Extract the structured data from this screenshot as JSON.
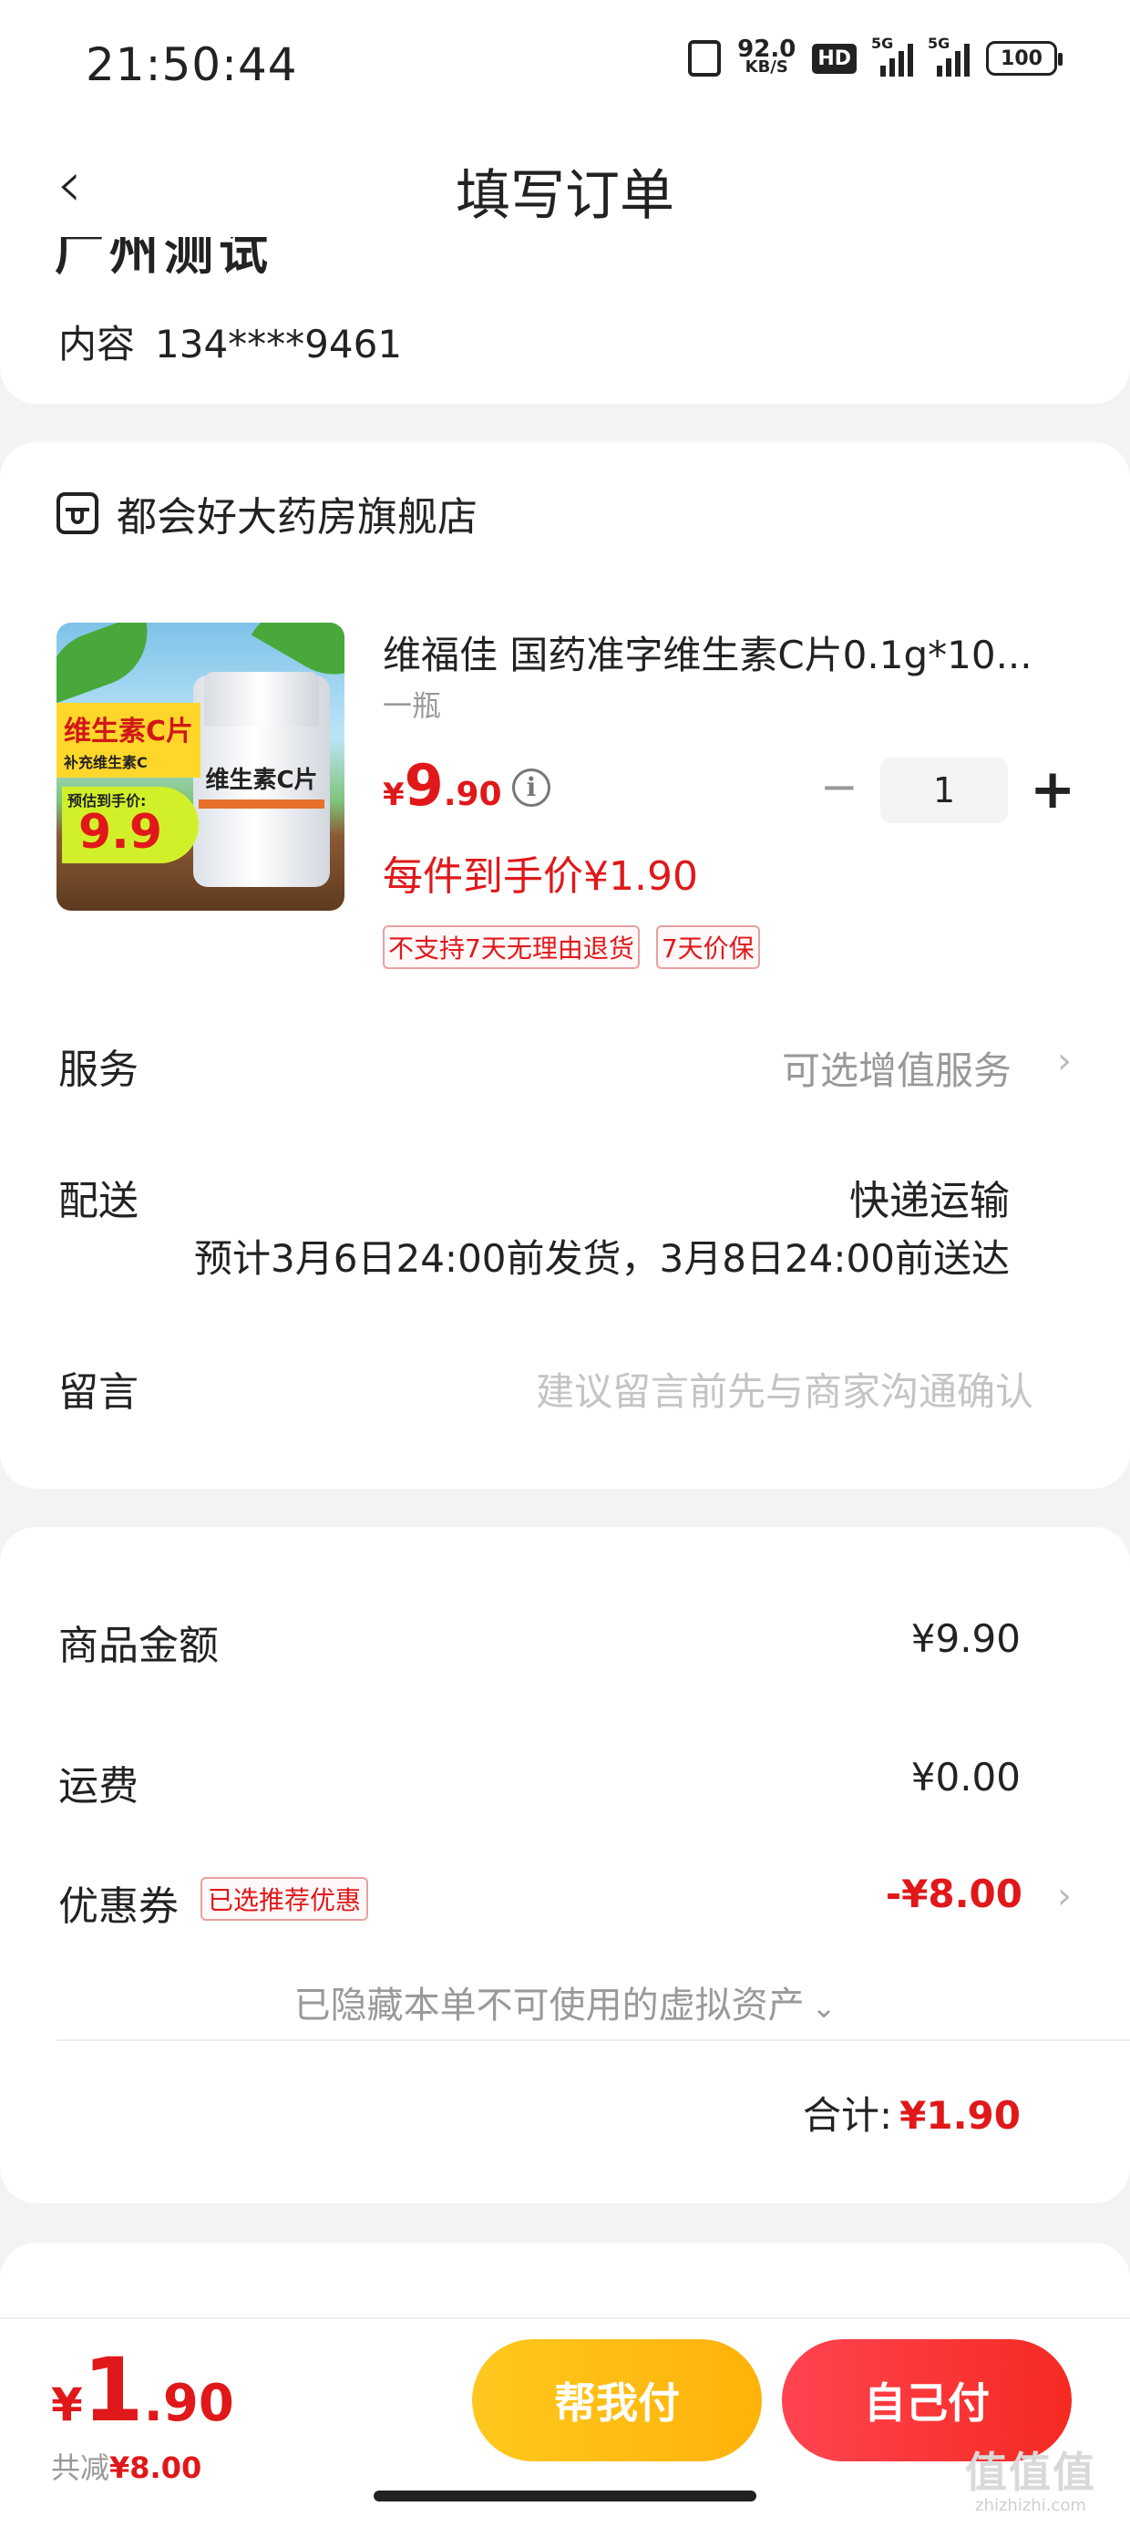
{
  "status_bar": {
    "time": "21:50:44",
    "net_speed_value": "92.0",
    "net_speed_unit": "KB/S",
    "hd_badge": "HD",
    "sig1_label": "5G",
    "sig2_label": "5G",
    "battery": "100"
  },
  "header": {
    "back_icon": "chevron-left-icon",
    "title": "填写订单"
  },
  "address": {
    "city_partial": "广州测试",
    "contact_label": "内容",
    "phone": "134****9461"
  },
  "store": {
    "name": "都会好大药房旗舰店",
    "icon": "store-icon"
  },
  "product": {
    "name": "维福佳 国药准字维生素C片0.1g*10...",
    "spec": "一瓶",
    "price_currency": "¥",
    "price_int": "9",
    "price_dec": ".90",
    "unit_price": "每件到手价¥1.90",
    "quantity": "1",
    "minus_label": "−",
    "plus_label": "+",
    "tags": [
      "不支持7天无理由退货",
      "7天价保"
    ],
    "image": {
      "tag_title": "维生素C片",
      "tag_sub": "补充维生素C",
      "badge_label": "预估到手价:",
      "badge_value": "9.9",
      "bottle_label": "维生素C片"
    }
  },
  "rows": {
    "service_label": "服务",
    "service_value": "可选增值服务",
    "delivery_label": "配送",
    "delivery_method": "快递运输",
    "delivery_eta": "预计3月6日24:00前发货，3月8日24:00前送达",
    "message_label": "留言",
    "message_placeholder": "建议留言前先与商家沟通确认"
  },
  "pricing": {
    "goods_label": "商品金额",
    "goods_value": "¥9.90",
    "freight_label": "运费",
    "freight_value": "¥0.00",
    "coupon_label": "优惠券",
    "coupon_tag": "已选推荐优惠",
    "coupon_value": "-¥8.00",
    "hidden_assets": "已隐藏本单不可使用的虚拟资产",
    "total_label": "合计:",
    "total_value": "¥1.90"
  },
  "bottom_bar": {
    "pay_currency": "¥",
    "pay_int": "1",
    "pay_dec": ".90",
    "saved_label": "共减",
    "saved_value": "¥8.00",
    "help_pay_label": "帮我付",
    "self_pay_label": "自己付"
  },
  "watermark": {
    "logo": "值值值",
    "domain": "zhizhizhi.com"
  },
  "colors": {
    "accent_red": "#e0181a",
    "help_button": "#ffb20a",
    "self_button": "#f52a22"
  }
}
